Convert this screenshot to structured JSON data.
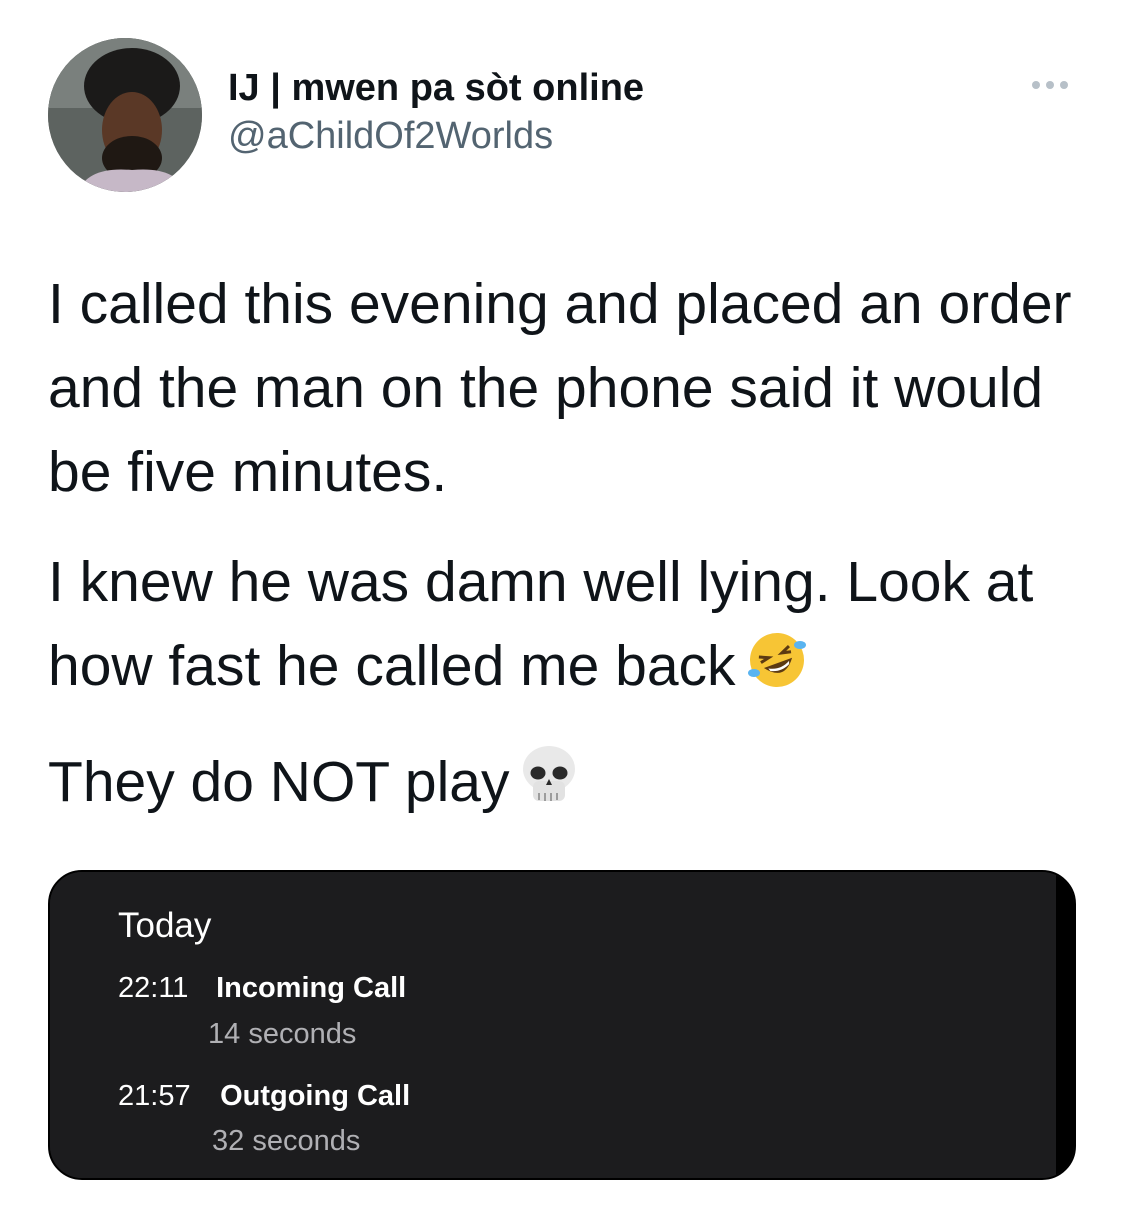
{
  "author": {
    "display_name": "IJ | mwen pa sòt online",
    "handle": "@aChildOf2Worlds"
  },
  "tweet": {
    "paragraphs": [
      "I called this evening and placed an order and the man on the phone said it would be five minutes.",
      "I knew he was damn well lying. Look at how fast he called me back",
      "They do NOT play"
    ],
    "emojis": [
      "rolling-on-floor-laughing-emoji",
      "skull-emoji"
    ]
  },
  "call_log": {
    "title": "Today",
    "entries": [
      {
        "time": "22:11",
        "type": "Incoming Call",
        "duration": "14 seconds"
      },
      {
        "time": "21:57",
        "type": "Outgoing Call",
        "duration": "32 seconds"
      }
    ]
  },
  "icons": {
    "more": "more-options-icon"
  },
  "colors": {
    "text": "#0f1419",
    "secondary": "#536471",
    "media_bg": "#1c1c1e"
  }
}
